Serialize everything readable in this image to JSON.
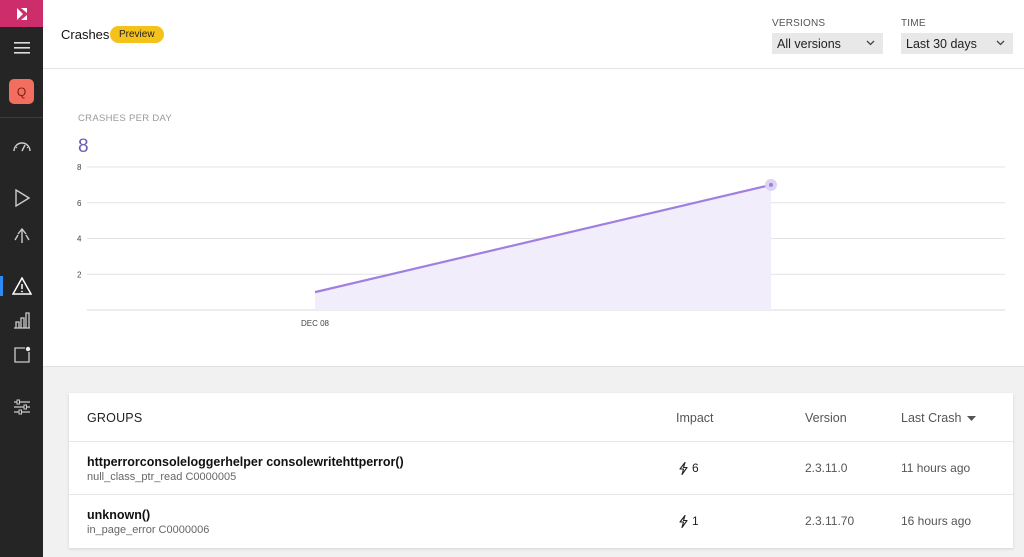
{
  "sidebar": {
    "app_initial": "Q",
    "items": [
      {
        "icon": "menu-icon"
      },
      {
        "icon": "dashboard-icon"
      },
      {
        "icon": "build-icon"
      },
      {
        "icon": "distribute-icon"
      },
      {
        "icon": "diagnostics-icon"
      },
      {
        "icon": "analytics-icon"
      },
      {
        "icon": "push-icon"
      },
      {
        "icon": "settings-icon"
      }
    ],
    "active": "diagnostics-icon",
    "colors": {
      "logo": "#cd2e6b",
      "app": "#f36e5e",
      "active_bar": "#2c8bf5"
    }
  },
  "header": {
    "title": "Crashes",
    "badge": "Preview",
    "versions_label": "VERSIONS",
    "versions_value": "All versions",
    "time_label": "TIME",
    "time_value": "Last 30 days"
  },
  "chart_data": {
    "type": "area",
    "title": "CRASHES PER DAY",
    "total": "8",
    "x": [
      "DEC 08",
      ""
    ],
    "values": [
      1,
      7
    ],
    "yticks": [
      2,
      4,
      6,
      8
    ],
    "ylim": [
      0,
      8
    ],
    "grid": true,
    "color": "#a07fe0"
  },
  "groups": {
    "header": {
      "groups": "GROUPS",
      "impact": "Impact",
      "version": "Version",
      "last_crash": "Last Crash"
    },
    "rows": [
      {
        "name": "httperrorconsoleloggerhelper consolewritehttperror()",
        "sub": "null_class_ptr_read C0000005",
        "impact": "6",
        "version": "2.3.11.0",
        "last_crash": "11 hours ago"
      },
      {
        "name": "unknown()",
        "sub": "in_page_error C0000006",
        "impact": "1",
        "version": "2.3.11.70",
        "last_crash": "16 hours ago"
      }
    ]
  }
}
